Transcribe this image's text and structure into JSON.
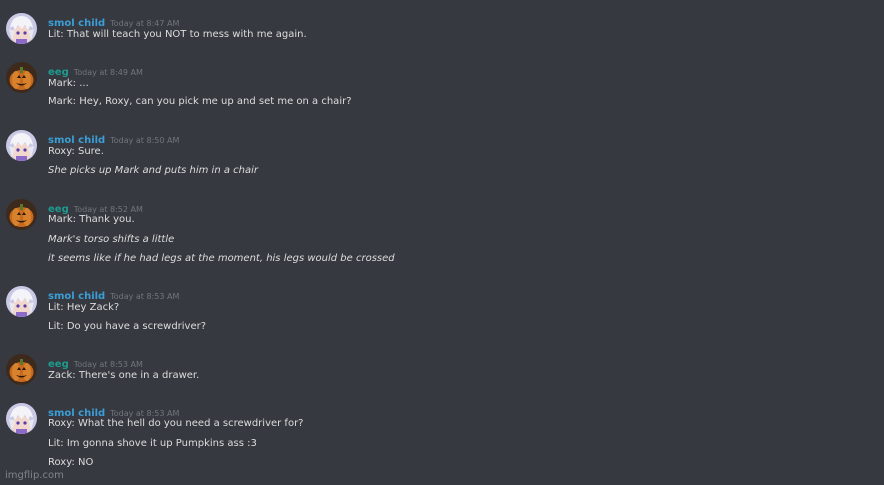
{
  "colors": {
    "background": "#36393f",
    "username_smol_child": "#3b9ed6",
    "username_eeg": "#1f9a8e",
    "message_text": "#dcddde",
    "timestamp": "#72767d"
  },
  "messages": [
    {
      "author": "smol child",
      "avatar_icon": "white-haired-anime-avatar-icon",
      "timestamp": "Today at 8:47 AM",
      "lines": [
        {
          "text": "Lit: That will teach you NOT to mess with me again.",
          "italic": false
        }
      ]
    },
    {
      "author": "eeg",
      "avatar_icon": "pumpkin-avatar-icon",
      "timestamp": "Today at 8:49 AM",
      "lines": [
        {
          "text": "Mark: ...",
          "italic": false
        },
        {
          "text": "Mark: Hey, Roxy, can you pick me up and set me on a chair?",
          "italic": false
        }
      ]
    },
    {
      "author": "smol child",
      "avatar_icon": "white-haired-anime-avatar-icon",
      "timestamp": "Today at 8:50 AM",
      "lines": [
        {
          "text": "Roxy: Sure.",
          "italic": false
        },
        {
          "text": "She picks up Mark and puts him in a chair",
          "italic": true
        }
      ]
    },
    {
      "author": "eeg",
      "avatar_icon": "pumpkin-avatar-icon",
      "timestamp": "Today at 8:52 AM",
      "lines": [
        {
          "text": "Mark: Thank you.",
          "italic": false
        },
        {
          "text": "Mark's torso shifts a little",
          "italic": true
        },
        {
          "text": "it seems like if he had legs at the moment, his legs would be crossed",
          "italic": true
        }
      ]
    },
    {
      "author": "smol child",
      "avatar_icon": "white-haired-anime-avatar-icon",
      "timestamp": "Today at 8:53 AM",
      "lines": [
        {
          "text": "Lit: Hey Zack?",
          "italic": false
        },
        {
          "text": "Lit: Do you have a screwdriver?",
          "italic": false
        }
      ]
    },
    {
      "author": "eeg",
      "avatar_icon": "pumpkin-avatar-icon",
      "timestamp": "Today at 8:53 AM",
      "lines": [
        {
          "text": "Zack: There's one in a drawer.",
          "italic": false
        }
      ]
    },
    {
      "author": "smol child",
      "avatar_icon": "white-haired-anime-avatar-icon",
      "timestamp": "Today at 8:53 AM",
      "lines": [
        {
          "text": "Roxy: What the hell do you need a screwdriver for?",
          "italic": false
        },
        {
          "text": "Lit: Im gonna shove it up Pumpkins ass :3",
          "italic": false
        },
        {
          "text": "Roxy: NO",
          "italic": false
        }
      ]
    }
  ],
  "watermark": "imgflip.com"
}
